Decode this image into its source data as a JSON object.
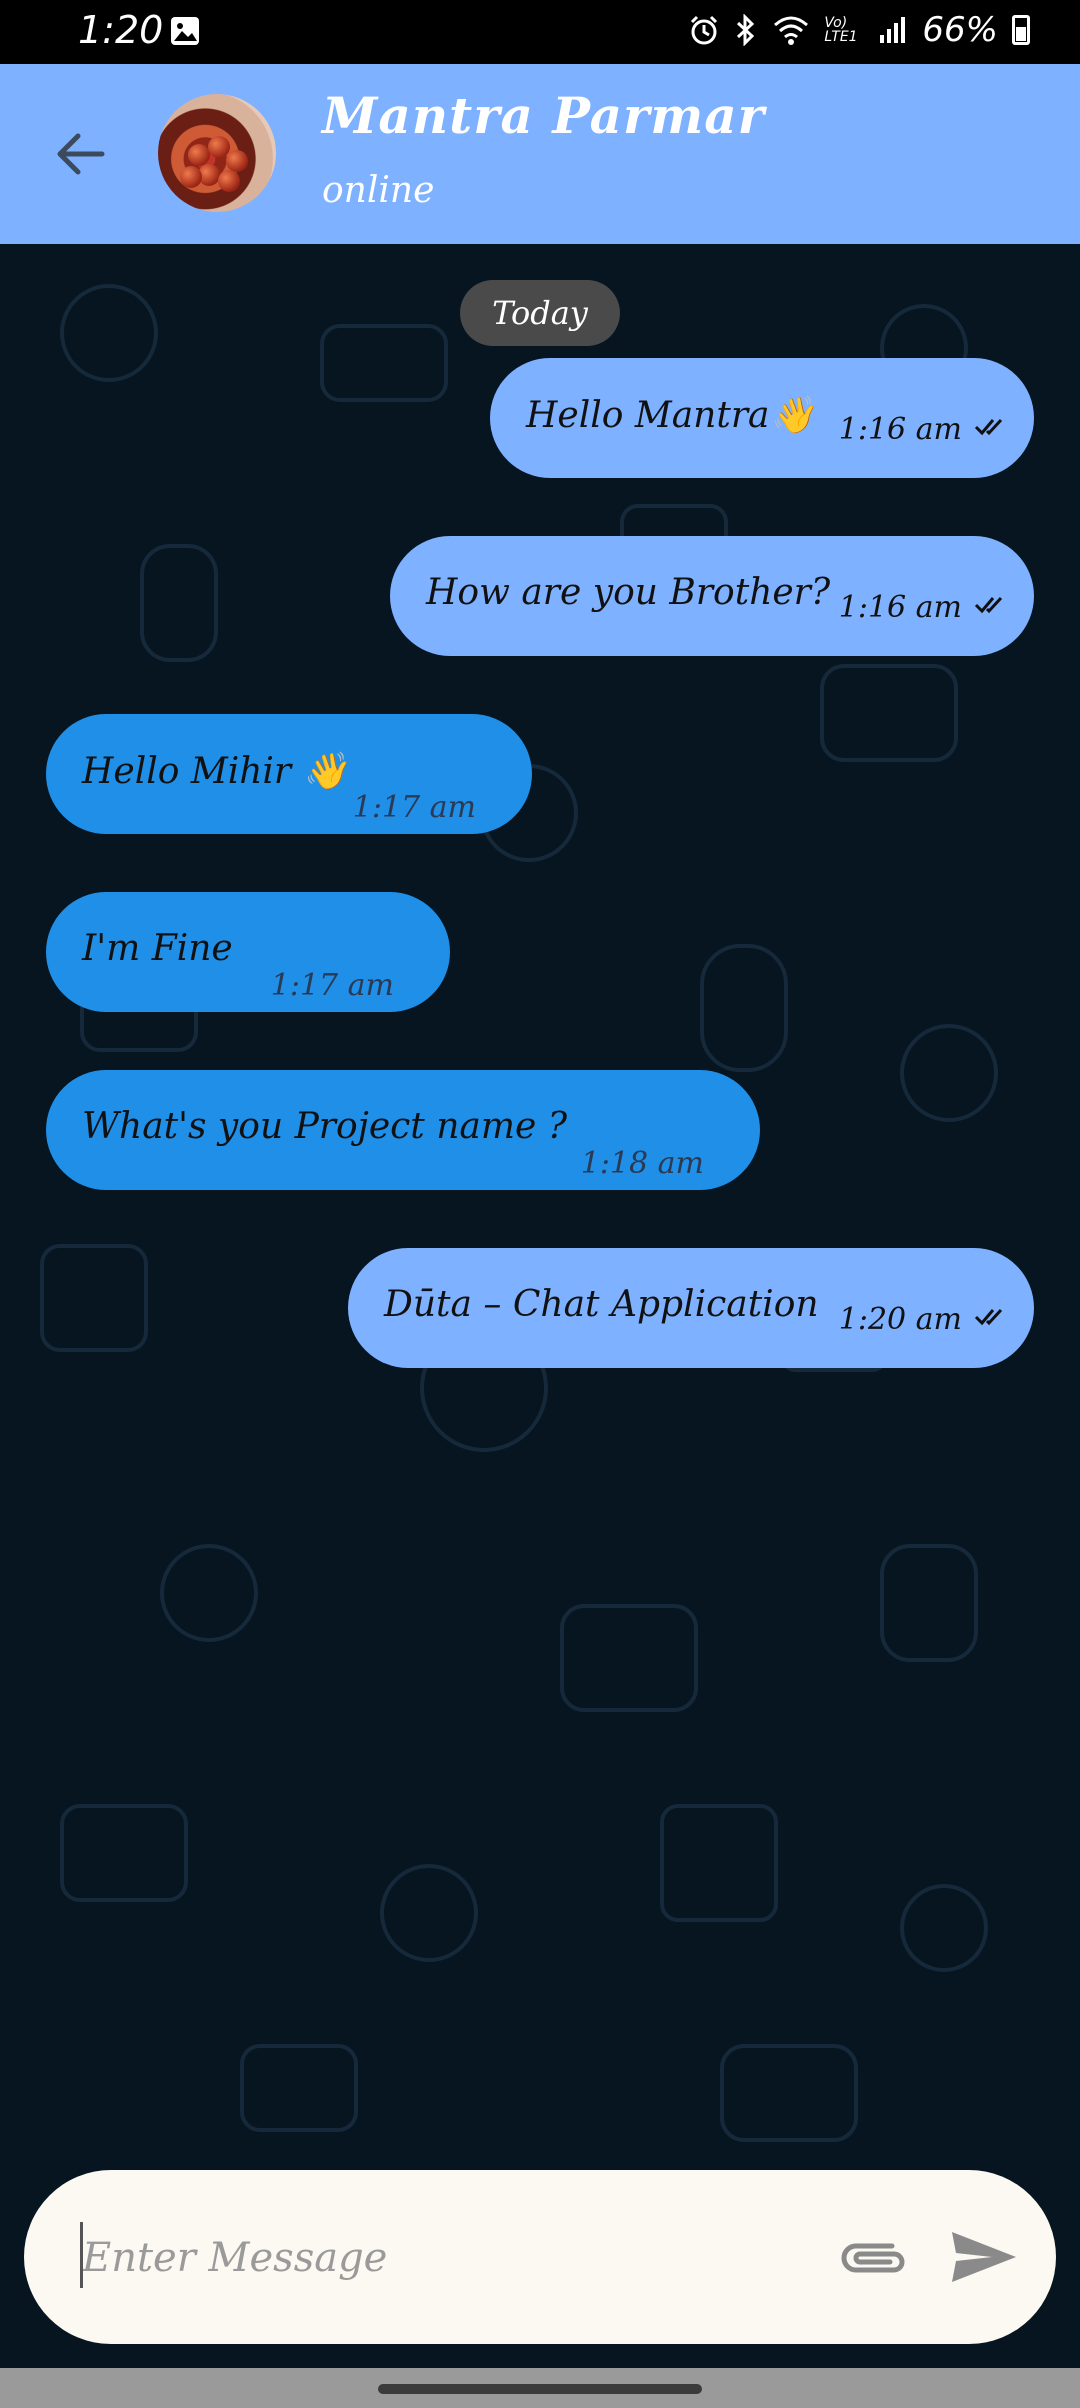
{
  "status_bar": {
    "time": "1:20",
    "network": "Vo) LTE1",
    "battery": "66%"
  },
  "header": {
    "contact_name": "Mantra Parmar",
    "contact_status": "online"
  },
  "date_chip": "Today",
  "messages": [
    {
      "direction": "sent",
      "text": "Hello Mantra👋",
      "time": "1:16 am",
      "read_state": "double-tick"
    },
    {
      "direction": "sent",
      "text": "How are you Brother?",
      "time": "1:16 am",
      "read_state": "double-tick"
    },
    {
      "direction": "received",
      "text": "Hello Mihir 👋",
      "time": "1:17 am"
    },
    {
      "direction": "received",
      "text": "I'm  Fine",
      "time": "1:17 am"
    },
    {
      "direction": "received",
      "text": "What's you Project name ?",
      "time": "1:18 am"
    },
    {
      "direction": "sent",
      "text": "Dūta – Chat Application",
      "time": "1:20 am",
      "read_state": "double-tick"
    }
  ],
  "composer": {
    "placeholder": "Enter Message",
    "value": ""
  },
  "colors": {
    "header": "#7eb1ff",
    "sent_bubble": "#7eb1ff",
    "received_bubble": "#1f8fe8",
    "chat_background": "#061520",
    "composer": "#fcf8f2"
  },
  "icons": {
    "back": "arrow-left-icon",
    "attach": "paperclip-icon",
    "send": "send-icon",
    "read": "double-check-icon"
  }
}
